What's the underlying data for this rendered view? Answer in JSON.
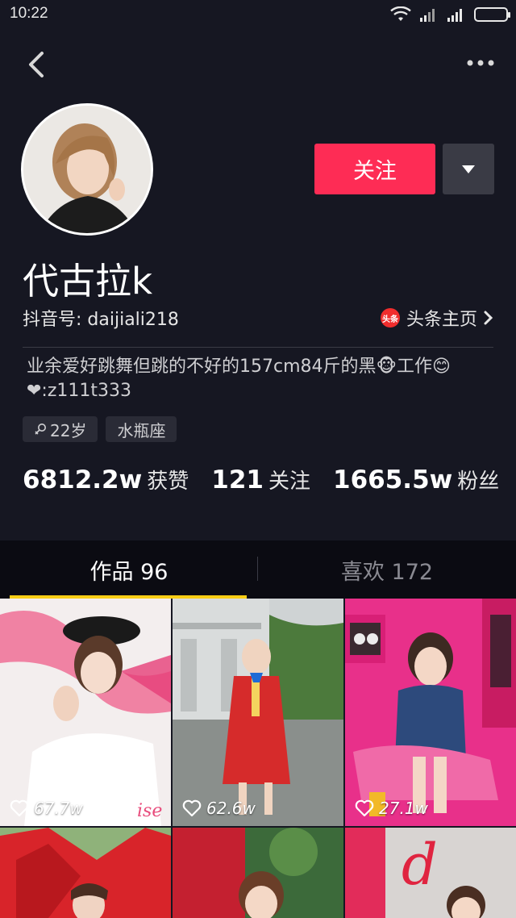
{
  "status_bar": {
    "time": "10:22"
  },
  "profile": {
    "name": "代古拉k",
    "douyin_id": "抖音号: daijiali218",
    "toutiao_badge": "头条",
    "toutiao_label": "头条主页",
    "bio_line1": "业余爱好跳舞但跳的不好的157cm84斤的黑🐵工作😊",
    "bio_line2": "❤:z111t333",
    "tags": [
      "22岁",
      "水瓶座"
    ],
    "follow_label": "关注"
  },
  "stats": {
    "likes_num": "6812.2w",
    "likes_label": "获赞",
    "following_num": "121",
    "following_label": "关注",
    "fans_num": "1665.5w",
    "fans_label": "粉丝"
  },
  "tabs": {
    "works": "作品 96",
    "liked": "喜欢 172"
  },
  "videos": [
    {
      "likes": "67.7w"
    },
    {
      "likes": "62.6w"
    },
    {
      "likes": "27.1w"
    }
  ],
  "colors": {
    "background": "#161722",
    "accent": "#fe2c55",
    "tab_underline": "#face15"
  }
}
